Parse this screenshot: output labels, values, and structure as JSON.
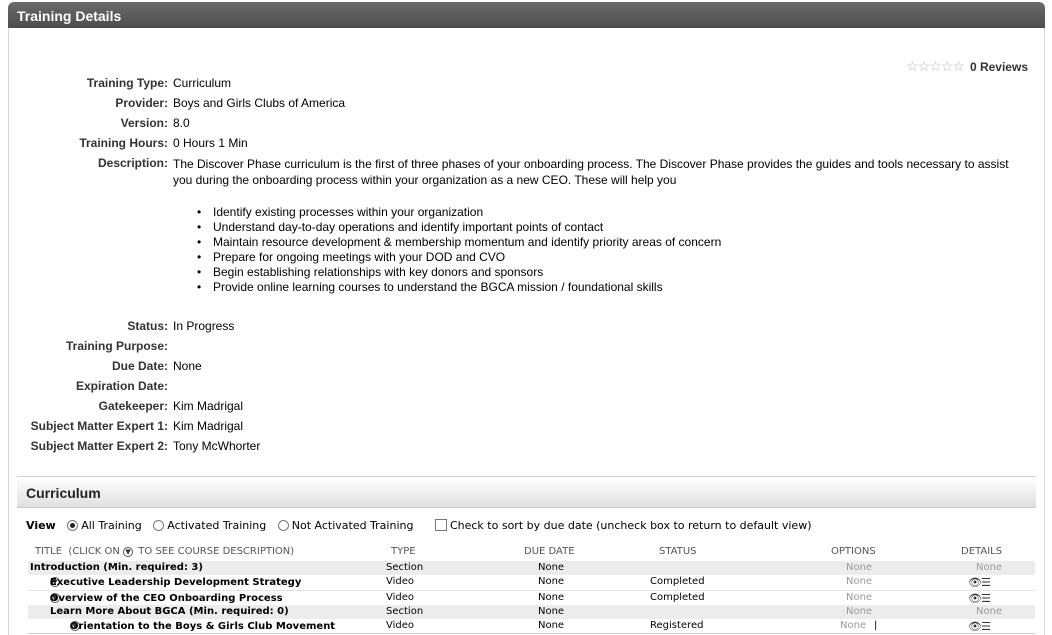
{
  "header": {
    "title": "Training Details"
  },
  "reviews": {
    "stars": "☆☆☆☆☆",
    "label": "0 Reviews"
  },
  "fields": {
    "training_type": {
      "label": "Training Type:",
      "value": "Curriculum"
    },
    "provider": {
      "label": "Provider:",
      "value": "Boys and Girls Clubs of America"
    },
    "version": {
      "label": "Version:",
      "value": "8.0"
    },
    "training_hours": {
      "label": "Training Hours:",
      "value": "0 Hours 1 Min"
    },
    "status": {
      "label": "Status:",
      "value": "In Progress"
    },
    "training_purpose": {
      "label": "Training Purpose:",
      "value": ""
    },
    "due_date": {
      "label": "Due Date:",
      "value": "None"
    },
    "expiration_date": {
      "label": "Expiration Date:",
      "value": ""
    },
    "gatekeeper": {
      "label": "Gatekeeper:",
      "value": "Kim Madrigal"
    },
    "sme1": {
      "label": "Subject Matter Expert 1:",
      "value": "Kim Madrigal"
    },
    "sme2": {
      "label": "Subject Matter Expert 2:",
      "value": "Tony McWhorter"
    }
  },
  "description": {
    "label": "Description:",
    "text": "The Discover Phase curriculum is the first of three phases of your onboarding process. The Discover Phase provides the guides and tools necessary to assist you during the onboarding process within your organization as a new CEO. These will help you",
    "bullets": [
      "Identify existing processes within your organization",
      "Understand day-to-day operations and identify important points of contact",
      "Maintain resource development & membership momentum and identify priority areas of concern",
      "Prepare for ongoing meetings with your DOD and CVO",
      "Begin establishing relationships with key donors and sponsors",
      "Provide online learning courses to understand the BGCA mission / foundational skills"
    ]
  },
  "curriculum": {
    "title": "Curriculum",
    "view_label": "View",
    "filters": [
      "All Training",
      "Activated Training",
      "Not Activated Training"
    ],
    "selected_filter": "All Training",
    "sort_checkbox_label": "Check to sort by due date (uncheck box to return to default view)",
    "columns": {
      "title": "TITLE",
      "title_hint_pre": "(CLICK ON",
      "title_hint_post": "TO SEE COURSE DESCRIPTION)",
      "type": "TYPE",
      "due_date": "DUE DATE",
      "status": "STATUS",
      "options": "OPTIONS",
      "details": "DETAILS"
    },
    "rows": [
      {
        "title": "Introduction  (Min. required: 3)",
        "type": "Section",
        "due": "None",
        "status": "",
        "options": "None",
        "details": "None"
      },
      {
        "title": "Executive Leadership Development Strategy",
        "type": "Video",
        "due": "None",
        "status": "Completed",
        "options": "None",
        "details": ""
      },
      {
        "title": "Overview of the CEO Onboarding Process",
        "type": "Video",
        "due": "None",
        "status": "Completed",
        "options": "None",
        "details": ""
      },
      {
        "title": "Learn More About BGCA  (Min. required: 0)",
        "type": "Section",
        "due": "None",
        "status": "",
        "options": "None",
        "details": "None"
      },
      {
        "title": "Orientation to the Boys & Girls Club Movement",
        "type": "Video",
        "due": "None",
        "status": "Registered",
        "options": "None",
        "details": ""
      }
    ]
  }
}
